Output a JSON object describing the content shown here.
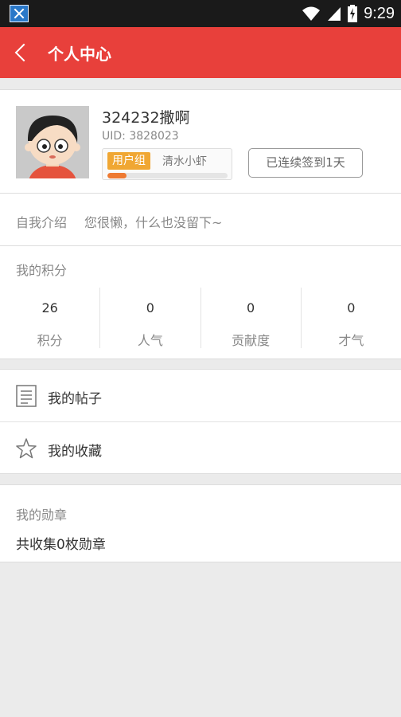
{
  "status_bar": {
    "time": "9:29"
  },
  "header": {
    "title": "个人中心"
  },
  "profile": {
    "username": "324232撒啊",
    "uid": "UID: 3828023",
    "group_badge": "用户组",
    "group_name": "清水小虾",
    "level_progress": 0.16,
    "checkin_label": "已连续签到1天"
  },
  "intro": {
    "label": "自我介绍",
    "text": "您很懒，什么也没留下~"
  },
  "points": {
    "title": "我的积分",
    "items": [
      {
        "value": "26",
        "label": "积分"
      },
      {
        "value": "0",
        "label": "人气"
      },
      {
        "value": "0",
        "label": "贡献度"
      },
      {
        "value": "0",
        "label": "才气"
      }
    ]
  },
  "menu": {
    "posts_label": "我的帖子",
    "favorites_label": "我的收藏"
  },
  "medals": {
    "title": "我的勋章",
    "text": "共收集0枚勋章"
  },
  "colors": {
    "header": "#e8403b",
    "badge": "#f0a733",
    "progress": "#ee7a32"
  },
  "icons": {
    "back": "chevron-left-icon",
    "posts": "document-icon",
    "favorites": "star-icon",
    "wifi": "wifi-icon",
    "signal": "signal-icon",
    "battery": "battery-charging-icon"
  }
}
